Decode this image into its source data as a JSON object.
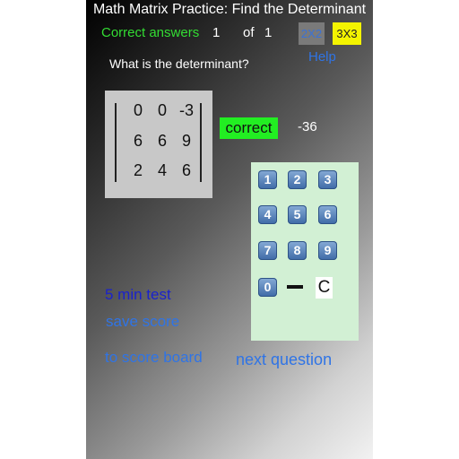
{
  "header": {
    "title": "Math Matrix Practice: Find the Determinant",
    "correct_label": "Correct answers",
    "correct_count": "1",
    "of_label": "of",
    "total_count": "1",
    "size_2x2": "2X2",
    "size_3x3": "3X3",
    "help": "Help"
  },
  "question": "What is the determinant?",
  "matrix": {
    "rows": [
      [
        "0",
        "0",
        "-3"
      ],
      [
        "6",
        "6",
        "9"
      ],
      [
        "2",
        "4",
        "6"
      ]
    ]
  },
  "result": "correct",
  "answer": "-36",
  "keypad": {
    "keys": [
      "1",
      "2",
      "3",
      "4",
      "5",
      "6",
      "7",
      "8",
      "9",
      "0"
    ],
    "clear": "C"
  },
  "links": {
    "test": "5 min test",
    "save": "save score",
    "board": "to score board",
    "next": "next question"
  },
  "colors": {
    "correct_label": "#33dd33",
    "link": "#2f74e6",
    "test_link": "#1a22cc",
    "result_bg": "#22ee22",
    "keypad_bg": "#d2f0d4",
    "selected_size": "#f4f400"
  }
}
